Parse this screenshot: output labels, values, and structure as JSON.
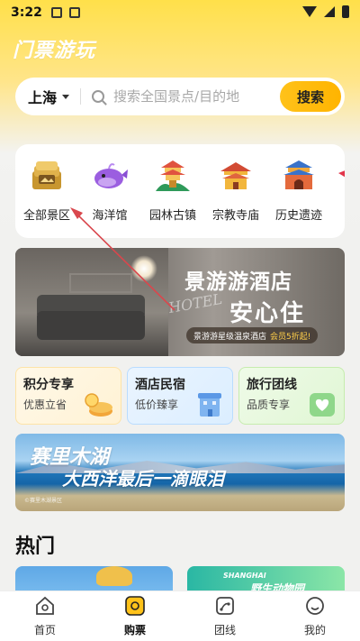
{
  "status_bar": {
    "time": "3:22"
  },
  "app": {
    "title": "门票游玩"
  },
  "search": {
    "city": "上海",
    "placeholder": "搜索全国景点/目的地",
    "button_label": "搜索"
  },
  "categories": [
    {
      "label": "全部景区",
      "icon": "ticket-stack-icon"
    },
    {
      "label": "海洋馆",
      "icon": "whale-icon"
    },
    {
      "label": "园林古镇",
      "icon": "pagoda-garden-icon"
    },
    {
      "label": "宗教寺庙",
      "icon": "temple-icon"
    },
    {
      "label": "历史遗迹",
      "icon": "historic-gate-icon"
    }
  ],
  "hotel_banner": {
    "headline": "景游游酒店",
    "headline2": "安心住",
    "script_text": "HOTEL",
    "subtext": "景游游星级温泉酒店",
    "highlight": "会员5折起!"
  },
  "features": [
    {
      "title": "积分专享",
      "subtitle": "优惠立省",
      "icon": "coins-icon"
    },
    {
      "title": "酒店民宿",
      "subtitle": "低价臻享",
      "icon": "hotel-building-icon"
    },
    {
      "title": "旅行团线",
      "subtitle": "品质专享",
      "icon": "heart-flag-icon"
    }
  ],
  "lake_banner": {
    "line1": "赛里木湖",
    "line2": "大西洋最后一滴眼泪",
    "credit": "©赛里木湖景区"
  },
  "hot_section": {
    "title": "热门",
    "cards": [
      {
        "label": ""
      },
      {
        "label": "SHANGHAI",
        "sub": "野生动物园"
      }
    ]
  },
  "tabs": [
    {
      "label": "首页",
      "icon": "home-icon"
    },
    {
      "label": "购票",
      "icon": "ticket-icon",
      "active": true
    },
    {
      "label": "团线",
      "icon": "route-icon"
    },
    {
      "label": "我的",
      "icon": "profile-icon"
    }
  ],
  "colors": {
    "accent": "#ffbf00",
    "header_gradient_top": "#ffe04a",
    "background": "#f1f1ef",
    "annotation_arrow": "#d9474d"
  }
}
